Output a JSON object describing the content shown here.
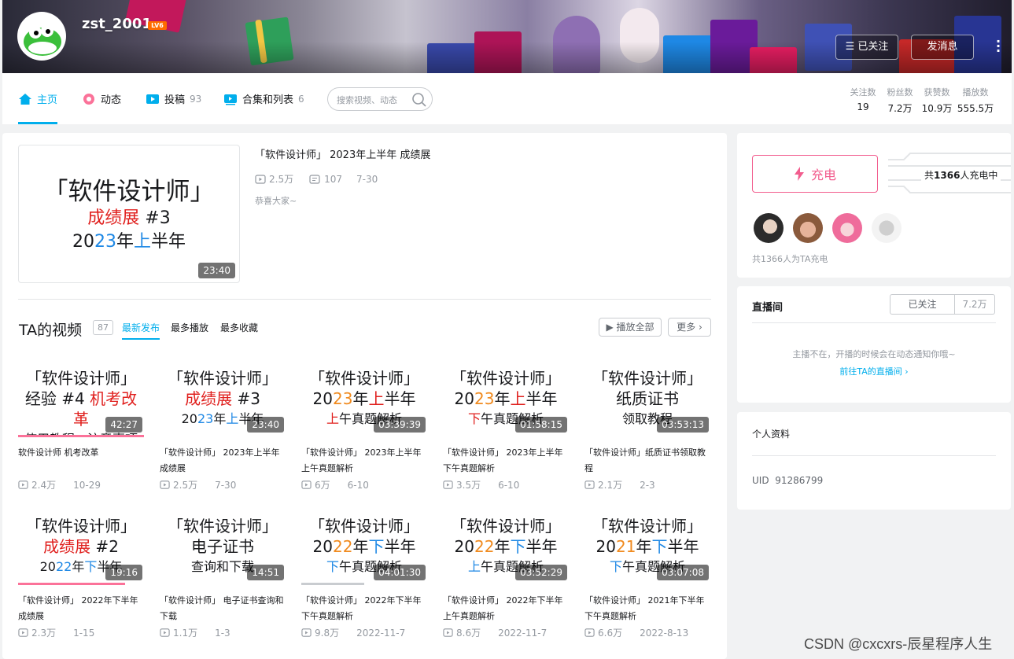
{
  "header": {
    "username": "zst_2001",
    "level_badge": "LV6",
    "followed_label": "已关注",
    "message_label": "发消息"
  },
  "nav": {
    "tabs": [
      {
        "label": "主页",
        "count": ""
      },
      {
        "label": "动态",
        "count": ""
      },
      {
        "label": "投稿",
        "count": "93"
      },
      {
        "label": "合集和列表",
        "count": "6"
      }
    ],
    "search_placeholder": "搜索视频、动态",
    "stats": [
      {
        "label": "关注数",
        "value": "19"
      },
      {
        "label": "粉丝数",
        "value": "7.2万"
      },
      {
        "label": "获赞数",
        "value": "10.9万"
      },
      {
        "label": "播放数",
        "value": "555.5万"
      }
    ]
  },
  "featured": {
    "thumb_line1": "「软件设计师」",
    "thumb_line2a": "成绩展",
    "thumb_line2b": " #3",
    "thumb_line3a": "20",
    "thumb_line3b": "23",
    "thumb_line3c": "年",
    "thumb_line3d": "上",
    "thumb_line3e": "半年",
    "duration": "23:40",
    "title": "「软件设计师」 2023年上半年 成绩展",
    "views": "2.5万",
    "danmaku": "107",
    "date": "7-30",
    "desc": "恭喜大家~"
  },
  "videos_section": {
    "title": "TA的视频",
    "count": "87",
    "tabs": [
      "最新发布",
      "最多播放",
      "最多收藏"
    ],
    "play_all": "播放全部",
    "more": "更多"
  },
  "videos": [
    {
      "lines": [
        [
          "「软件设计师」",
          "k"
        ],
        [
          "经验 #4 ",
          "k",
          "机考改革",
          "r"
        ],
        [
          "使用教程、注意事项",
          "k"
        ]
      ],
      "duration": "42:27",
      "title": "软件设计师 机考改革",
      "views": "2.4万",
      "date": "10-29",
      "progress": 1.0
    },
    {
      "lines": [
        [
          "「软件设计师」",
          "k"
        ],
        [
          "成绩展",
          "r",
          " #3",
          "k"
        ],
        [
          "20",
          "k",
          "23",
          "b",
          "年",
          "k",
          "上",
          "b",
          "半年",
          "k"
        ]
      ],
      "duration": "23:40",
      "title": "「软件设计师」 2023年上半年 成绩展",
      "views": "2.5万",
      "date": "7-30",
      "progress": 0
    },
    {
      "lines": [
        [
          "「软件设计师」",
          "k"
        ],
        [
          "20",
          "k",
          "23",
          "o",
          "年",
          "k",
          "上",
          "r",
          "半年",
          "k"
        ],
        [
          "上",
          "r",
          "午真题解析",
          "k"
        ]
      ],
      "duration": "03:39:39",
      "title": "「软件设计师」 2023年上半年上午真题解析",
      "views": "6万",
      "date": "6-10",
      "progress": 0
    },
    {
      "lines": [
        [
          "「软件设计师」",
          "k"
        ],
        [
          "20",
          "k",
          "23",
          "o",
          "年",
          "k",
          "上",
          "r",
          "半年",
          "k"
        ],
        [
          "下",
          "r",
          "午真题解析",
          "k"
        ]
      ],
      "duration": "01:58:15",
      "title": "「软件设计师」 2023年上半年下午真题解析",
      "views": "3.5万",
      "date": "6-10",
      "progress": 0
    },
    {
      "lines": [
        [
          "「软件设计师」",
          "k"
        ],
        [
          "纸质证书",
          "k"
        ],
        [
          "领取教程",
          "k"
        ]
      ],
      "duration": "03:53:13",
      "title": "「软件设计师」纸质证书领取教程",
      "views": "2.1万",
      "date": "2-3",
      "progress": 0
    },
    {
      "lines": [
        [
          "「软件设计师」",
          "k"
        ],
        [
          "成绩展",
          "r",
          " #2",
          "k"
        ],
        [
          "20",
          "k",
          "22",
          "b",
          "年",
          "k",
          "下",
          "b",
          "半年",
          "k"
        ]
      ],
      "duration": "19:16",
      "title": "「软件设计师」 2022年下半年 成绩展",
      "views": "2.3万",
      "date": "1-15",
      "progress": 0.85
    },
    {
      "lines": [
        [
          "「软件设计师」",
          "k"
        ],
        [
          "电子证书",
          "k"
        ],
        [
          "查询和下载",
          "k"
        ]
      ],
      "duration": "14:51",
      "title": "「软件设计师」 电子证书查询和下载",
      "views": "1.1万",
      "date": "1-3",
      "progress": 0
    },
    {
      "lines": [
        [
          "「软件设计师」",
          "k"
        ],
        [
          "20",
          "k",
          "22",
          "o",
          "年",
          "k",
          "下",
          "b",
          "半年",
          "k"
        ],
        [
          "下",
          "b",
          "午真题解析",
          "k"
        ]
      ],
      "duration": "04:01:30",
      "title": "「软件设计师」 2022年下半年下午真题解析",
      "views": "9.8万",
      "date": "2022-11-7",
      "progress": 0.5
    },
    {
      "lines": [
        [
          "「软件设计师」",
          "k"
        ],
        [
          "20",
          "k",
          "22",
          "o",
          "年",
          "k",
          "下",
          "b",
          "半年",
          "k"
        ],
        [
          "上",
          "b",
          "午真题解析",
          "k"
        ]
      ],
      "duration": "03:52:29",
      "title": "「软件设计师」 2022年下半年上午真题解析",
      "views": "8.6万",
      "date": "2022-11-7",
      "progress": 0
    },
    {
      "lines": [
        [
          "「软件设计师」",
          "k"
        ],
        [
          "20",
          "k",
          "21",
          "o",
          "年",
          "k",
          "下",
          "b",
          "半年",
          "k"
        ],
        [
          "下",
          "b",
          "午真题解析",
          "k"
        ]
      ],
      "duration": "03:07:08",
      "title": "「软件设计师」 2021年下半年下午真题解析",
      "views": "6.6万",
      "date": "2022-8-13",
      "progress": 0
    }
  ],
  "charge": {
    "button": "充电",
    "count_prefix": "共",
    "count_num": "1366",
    "count_suffix": "人充电中",
    "note": "共1366人为TA充电"
  },
  "live": {
    "title": "直播间",
    "followed": "已关注",
    "fans": "7.2万",
    "message": "主播不在，开播的时候会在动态通知你哦~",
    "link": "前往TA的直播间"
  },
  "profile": {
    "title": "个人资料",
    "uid_label": "UID",
    "uid": "91286799"
  },
  "watermark": "CSDN @cxcxrs-辰星程序人生",
  "colors": {
    "accent": "#00aeec",
    "pink": "#fb7299",
    "red": "#e0201e",
    "blue": "#1e88e5",
    "orange": "#f08a1e"
  }
}
